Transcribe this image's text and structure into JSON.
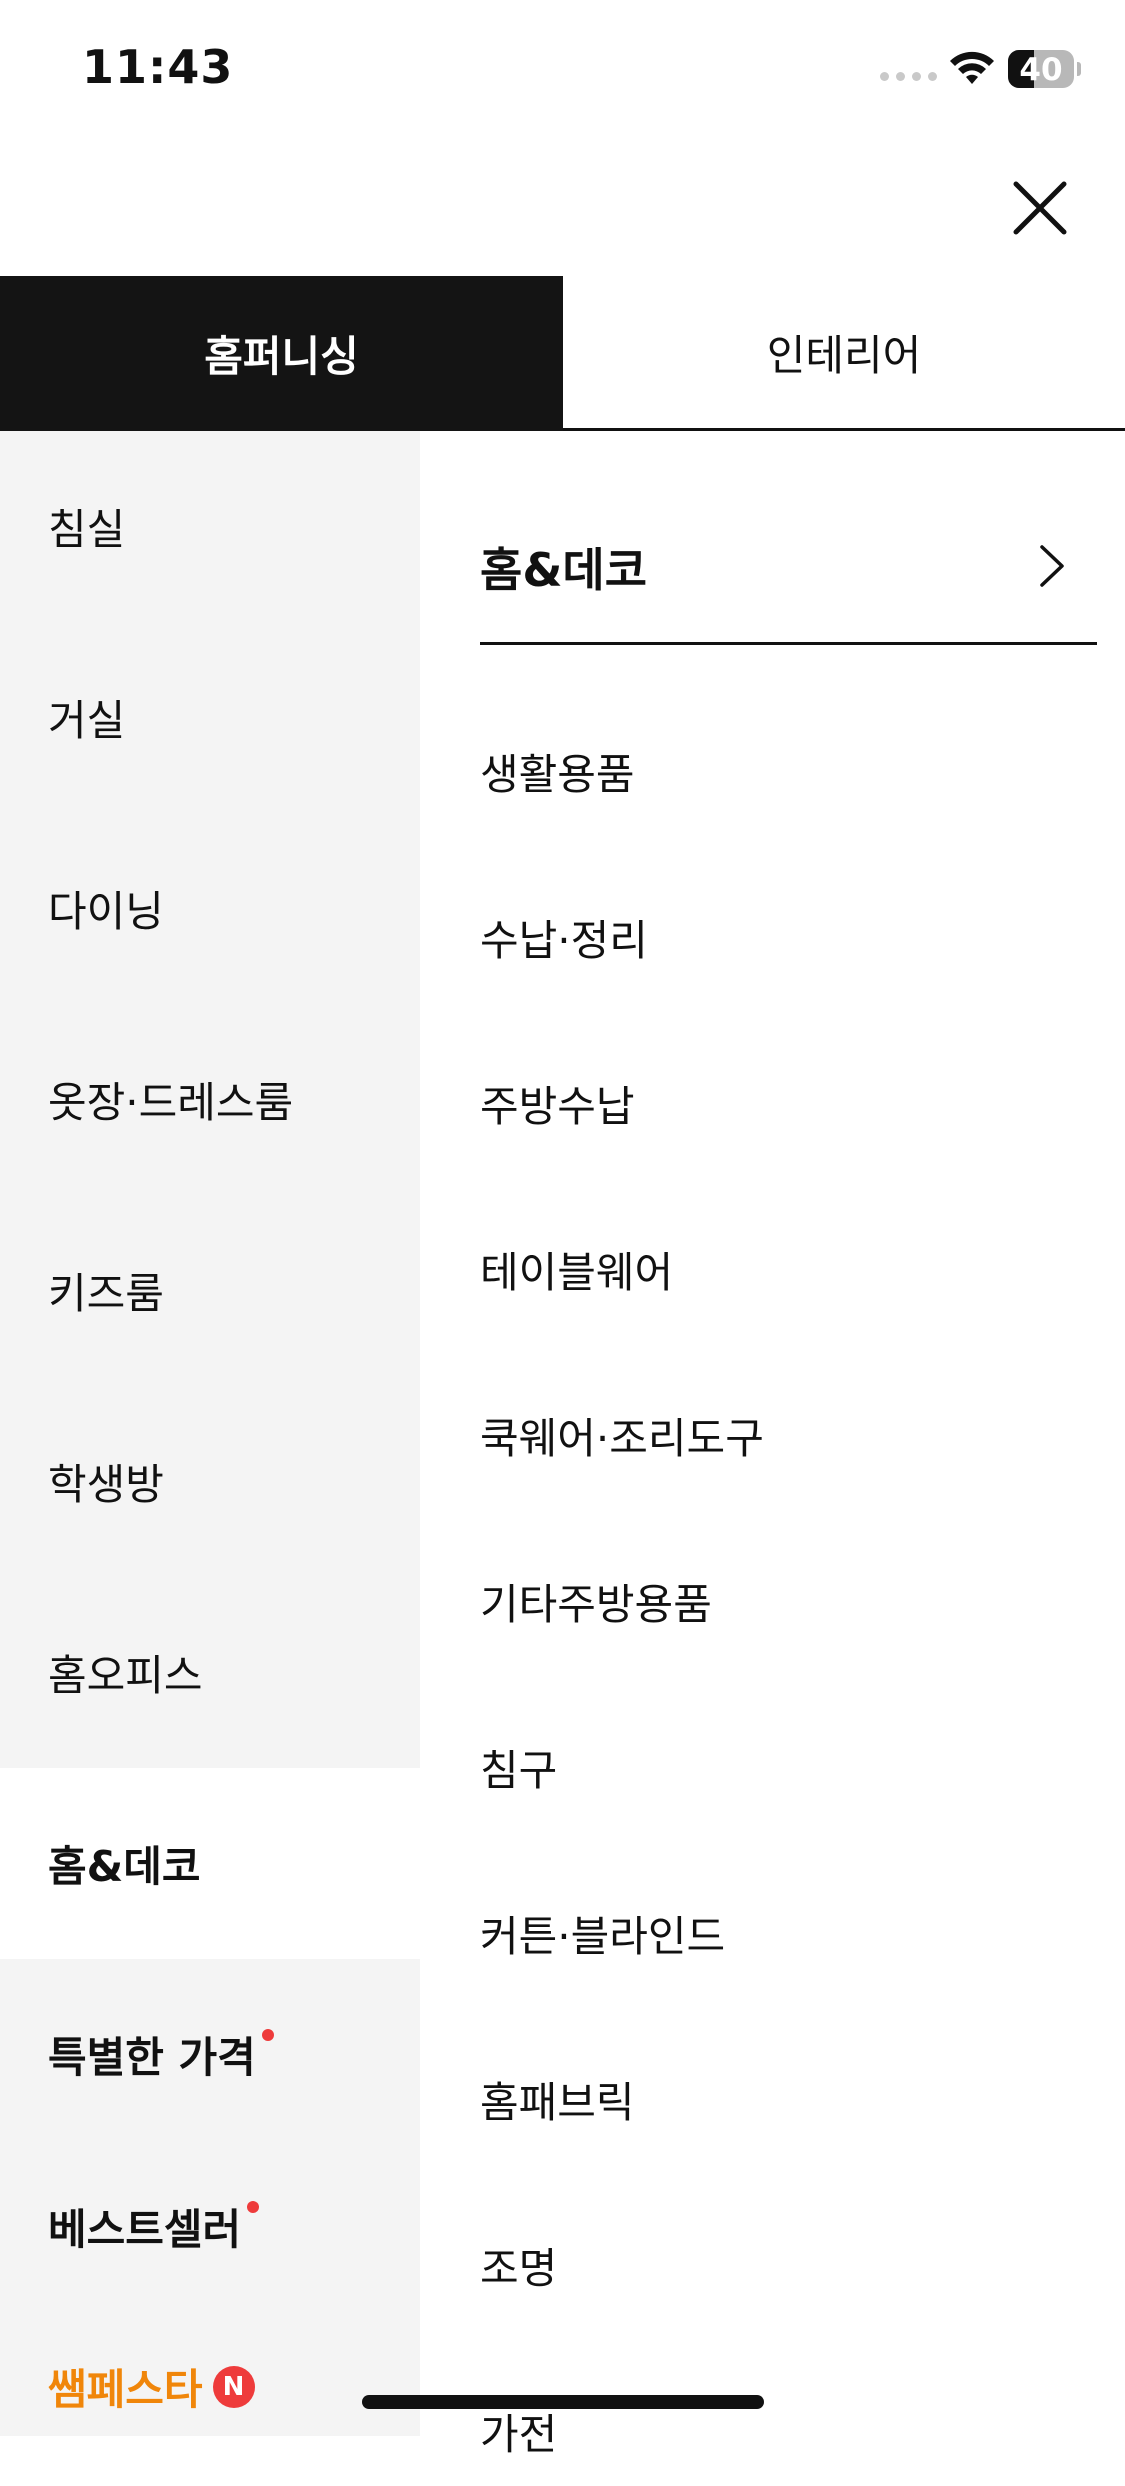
{
  "status_bar": {
    "time": "11:43",
    "battery": "40",
    "battery_level": 0.4
  },
  "header": {
    "close_icon": "close-icon"
  },
  "tabs": [
    {
      "label": "홈퍼니싱",
      "active": true
    },
    {
      "label": "인테리어",
      "active": false
    }
  ],
  "left_menu": [
    {
      "label": "침실"
    },
    {
      "label": "거실"
    },
    {
      "label": "다이닝"
    },
    {
      "label": "옷장·드레스룸"
    },
    {
      "label": "키즈룸"
    },
    {
      "label": "학생방"
    },
    {
      "label": "홈오피스"
    },
    {
      "label": "홈&데코",
      "selected": true
    },
    {
      "label": "특별한 가격",
      "dot": true
    },
    {
      "label": "베스트셀러",
      "dot": true
    },
    {
      "label": "쌤페스타",
      "badge": "N"
    }
  ],
  "right_menu": {
    "header": "홈&데코",
    "items": [
      "생활용품",
      "수납·정리",
      "주방수납",
      "테이블웨어",
      "쿡웨어·조리도구",
      "기타주방용품",
      "침구",
      "커튼·블라인드",
      "홈패브릭",
      "조명",
      "가전"
    ]
  },
  "colors": {
    "accent_orange": "#f0860a",
    "badge_red": "#ee3b3b",
    "tab_active_bg": "#141414",
    "left_panel_bg": "#f4f4f4"
  }
}
